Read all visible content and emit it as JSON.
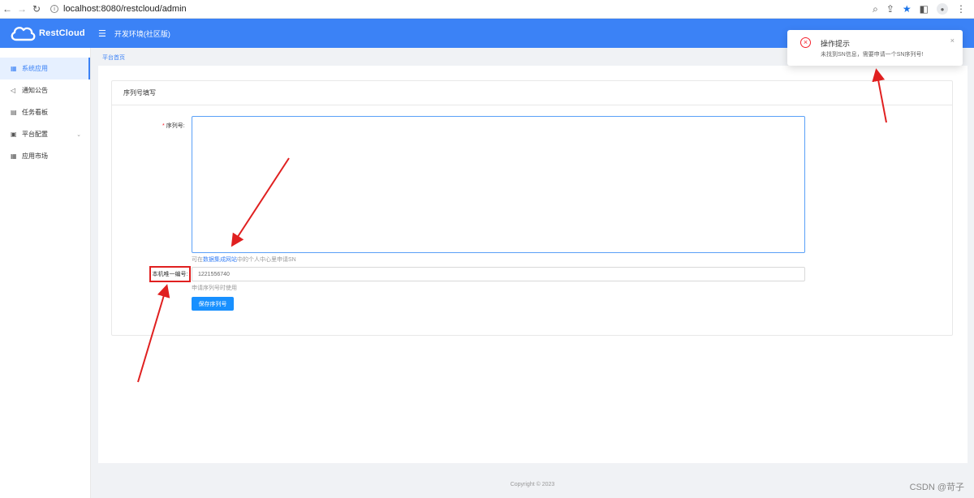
{
  "browser": {
    "url": "localhost:8080/restcloud/admin"
  },
  "header": {
    "logo_text": "RestCloud",
    "env_label": "开发环境(社区版)"
  },
  "sidebar": {
    "items": [
      {
        "label": "系统应用",
        "icon": "grid-icon"
      },
      {
        "label": "通知公告",
        "icon": "megaphone-icon"
      },
      {
        "label": "任务看板",
        "icon": "board-icon"
      },
      {
        "label": "平台配置",
        "icon": "settings-icon"
      },
      {
        "label": "应用市场",
        "icon": "apps-icon"
      }
    ]
  },
  "breadcrumb": "平台首页",
  "card": {
    "title": "序列号填写"
  },
  "form": {
    "sn_label": "序列号:",
    "sn_value": "",
    "sn_help_prefix": "可在",
    "sn_help_link": "数据集成网站",
    "sn_help_suffix": "中的个人中心里申请SN",
    "machine_id_label": "本机唯一编号:",
    "machine_id_value": "1221556740",
    "machine_id_help": "申请序列号时使用",
    "save_button": "保存序列号"
  },
  "notification": {
    "title": "操作提示",
    "message": "未找到SN信息，需要申请一个SN序列号!",
    "close": "×"
  },
  "footer": "Copyright © 2023",
  "watermark": "CSDN @苛子",
  "colors": {
    "primary": "#3b82f6",
    "error": "#f5222d",
    "annotation": "#e02020"
  }
}
